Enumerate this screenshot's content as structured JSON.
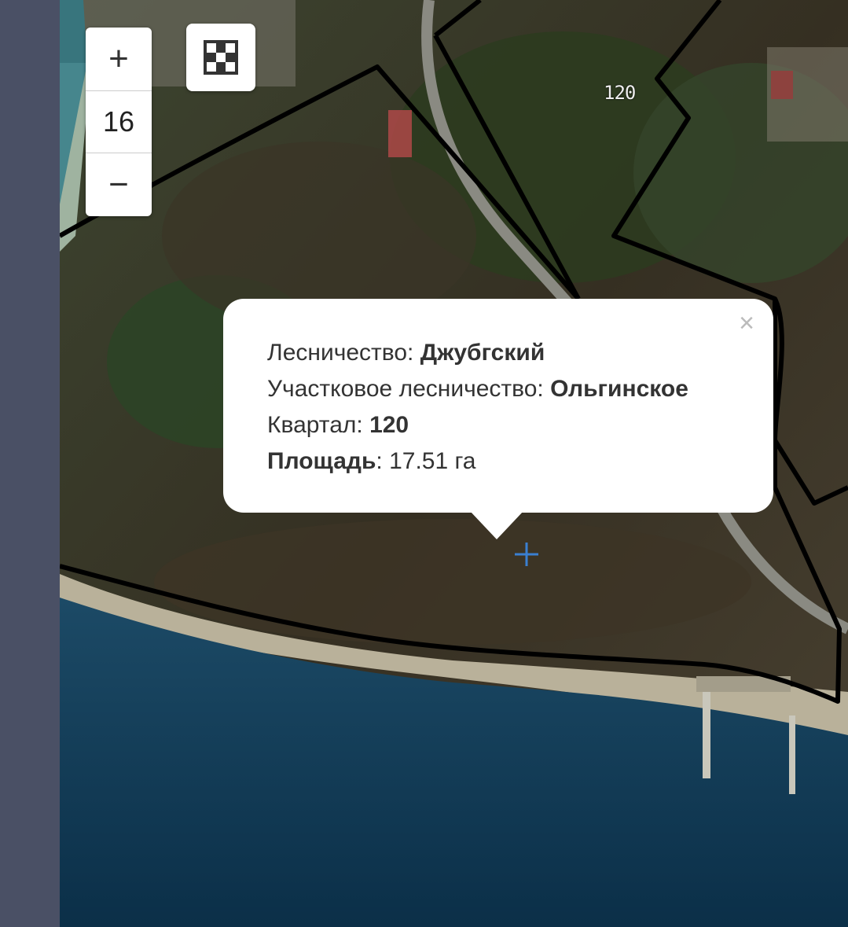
{
  "zoom": {
    "plus": "+",
    "level": "16",
    "minus": "−"
  },
  "layers_icon": "checker-layers-icon",
  "map": {
    "quarter_label": "120"
  },
  "popup": {
    "close": "×",
    "forestry_label": "Лесничество: ",
    "forestry_value": "Джубгский",
    "district_label": "Участковое лесничество: ",
    "district_value": "Ольгинское",
    "quarter_label": "Квартал: ",
    "quarter_value": "120",
    "area_label": "Площадь",
    "area_value": ": 17.51 га"
  },
  "colors": {
    "sidebar": "#4a5065",
    "sea": "#0f3a55",
    "forest": "#2f3a22",
    "boundary": "#000000"
  }
}
